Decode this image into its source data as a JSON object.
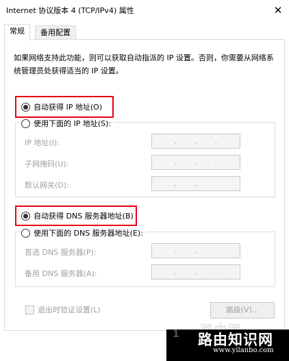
{
  "window": {
    "title": "Internet 协议版本 4 (TCP/IPv4) 属性",
    "close_glyph": "✕"
  },
  "tabs": [
    {
      "label": "常规",
      "active": true
    },
    {
      "label": "备用配置",
      "active": false
    }
  ],
  "description": "如果网络支持此功能，则可以获取自动指派的 IP 设置。否则，你需要从网络系统管理员处获得适当的 IP 设置。",
  "ip_section": {
    "auto_label": "自动获得 IP 地址(O)",
    "auto_selected": true,
    "manual_label": "使用下面的 IP 地址(S):",
    "fields": [
      {
        "label": "IP 地址(I):",
        "value": ". . ."
      },
      {
        "label": "子网掩码(U):",
        "value": ". . ."
      },
      {
        "label": "默认网关(D):",
        "value": ". . ."
      }
    ]
  },
  "dns_section": {
    "auto_label": "自动获得 DNS 服务器地址(B)",
    "auto_selected": true,
    "manual_label": "使用下面的 DNS 服务器地址(E):",
    "fields": [
      {
        "label": "首选 DNS 服务器(P):",
        "value": ". . ."
      },
      {
        "label": "备用 DNS 服务器(A):",
        "value": ". . ."
      }
    ]
  },
  "validate_checkbox": {
    "label": "退出时验证设置(L)",
    "checked": false
  },
  "advanced_button": {
    "label": "高级(V)..."
  },
  "watermark": {
    "left_text": "1",
    "gray_text": "路由器",
    "main_text": "路由知识网",
    "url": "www.yilanbo.com"
  },
  "colors": {
    "highlight_border": "#e60012",
    "disabled_text": "#a0a0a0"
  }
}
